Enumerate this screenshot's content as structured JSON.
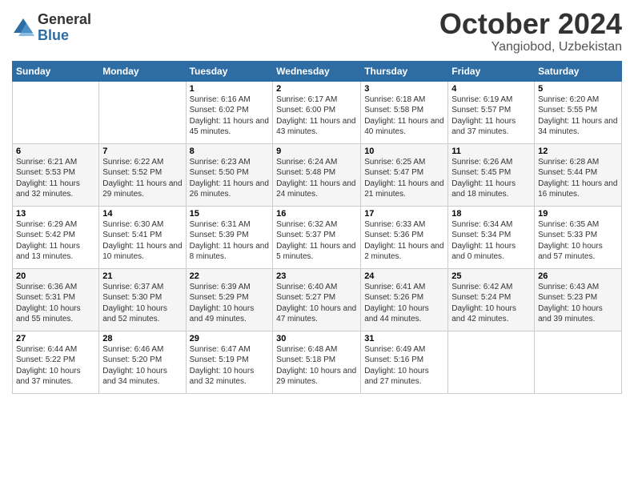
{
  "logo": {
    "general": "General",
    "blue": "Blue"
  },
  "title": "October 2024",
  "location": "Yangiobod, Uzbekistan",
  "days_of_week": [
    "Sunday",
    "Monday",
    "Tuesday",
    "Wednesday",
    "Thursday",
    "Friday",
    "Saturday"
  ],
  "weeks": [
    [
      {
        "num": "",
        "sunrise": "",
        "sunset": "",
        "daylight": ""
      },
      {
        "num": "",
        "sunrise": "",
        "sunset": "",
        "daylight": ""
      },
      {
        "num": "1",
        "sunrise": "Sunrise: 6:16 AM",
        "sunset": "Sunset: 6:02 PM",
        "daylight": "Daylight: 11 hours and 45 minutes."
      },
      {
        "num": "2",
        "sunrise": "Sunrise: 6:17 AM",
        "sunset": "Sunset: 6:00 PM",
        "daylight": "Daylight: 11 hours and 43 minutes."
      },
      {
        "num": "3",
        "sunrise": "Sunrise: 6:18 AM",
        "sunset": "Sunset: 5:58 PM",
        "daylight": "Daylight: 11 hours and 40 minutes."
      },
      {
        "num": "4",
        "sunrise": "Sunrise: 6:19 AM",
        "sunset": "Sunset: 5:57 PM",
        "daylight": "Daylight: 11 hours and 37 minutes."
      },
      {
        "num": "5",
        "sunrise": "Sunrise: 6:20 AM",
        "sunset": "Sunset: 5:55 PM",
        "daylight": "Daylight: 11 hours and 34 minutes."
      }
    ],
    [
      {
        "num": "6",
        "sunrise": "Sunrise: 6:21 AM",
        "sunset": "Sunset: 5:53 PM",
        "daylight": "Daylight: 11 hours and 32 minutes."
      },
      {
        "num": "7",
        "sunrise": "Sunrise: 6:22 AM",
        "sunset": "Sunset: 5:52 PM",
        "daylight": "Daylight: 11 hours and 29 minutes."
      },
      {
        "num": "8",
        "sunrise": "Sunrise: 6:23 AM",
        "sunset": "Sunset: 5:50 PM",
        "daylight": "Daylight: 11 hours and 26 minutes."
      },
      {
        "num": "9",
        "sunrise": "Sunrise: 6:24 AM",
        "sunset": "Sunset: 5:48 PM",
        "daylight": "Daylight: 11 hours and 24 minutes."
      },
      {
        "num": "10",
        "sunrise": "Sunrise: 6:25 AM",
        "sunset": "Sunset: 5:47 PM",
        "daylight": "Daylight: 11 hours and 21 minutes."
      },
      {
        "num": "11",
        "sunrise": "Sunrise: 6:26 AM",
        "sunset": "Sunset: 5:45 PM",
        "daylight": "Daylight: 11 hours and 18 minutes."
      },
      {
        "num": "12",
        "sunrise": "Sunrise: 6:28 AM",
        "sunset": "Sunset: 5:44 PM",
        "daylight": "Daylight: 11 hours and 16 minutes."
      }
    ],
    [
      {
        "num": "13",
        "sunrise": "Sunrise: 6:29 AM",
        "sunset": "Sunset: 5:42 PM",
        "daylight": "Daylight: 11 hours and 13 minutes."
      },
      {
        "num": "14",
        "sunrise": "Sunrise: 6:30 AM",
        "sunset": "Sunset: 5:41 PM",
        "daylight": "Daylight: 11 hours and 10 minutes."
      },
      {
        "num": "15",
        "sunrise": "Sunrise: 6:31 AM",
        "sunset": "Sunset: 5:39 PM",
        "daylight": "Daylight: 11 hours and 8 minutes."
      },
      {
        "num": "16",
        "sunrise": "Sunrise: 6:32 AM",
        "sunset": "Sunset: 5:37 PM",
        "daylight": "Daylight: 11 hours and 5 minutes."
      },
      {
        "num": "17",
        "sunrise": "Sunrise: 6:33 AM",
        "sunset": "Sunset: 5:36 PM",
        "daylight": "Daylight: 11 hours and 2 minutes."
      },
      {
        "num": "18",
        "sunrise": "Sunrise: 6:34 AM",
        "sunset": "Sunset: 5:34 PM",
        "daylight": "Daylight: 11 hours and 0 minutes."
      },
      {
        "num": "19",
        "sunrise": "Sunrise: 6:35 AM",
        "sunset": "Sunset: 5:33 PM",
        "daylight": "Daylight: 10 hours and 57 minutes."
      }
    ],
    [
      {
        "num": "20",
        "sunrise": "Sunrise: 6:36 AM",
        "sunset": "Sunset: 5:31 PM",
        "daylight": "Daylight: 10 hours and 55 minutes."
      },
      {
        "num": "21",
        "sunrise": "Sunrise: 6:37 AM",
        "sunset": "Sunset: 5:30 PM",
        "daylight": "Daylight: 10 hours and 52 minutes."
      },
      {
        "num": "22",
        "sunrise": "Sunrise: 6:39 AM",
        "sunset": "Sunset: 5:29 PM",
        "daylight": "Daylight: 10 hours and 49 minutes."
      },
      {
        "num": "23",
        "sunrise": "Sunrise: 6:40 AM",
        "sunset": "Sunset: 5:27 PM",
        "daylight": "Daylight: 10 hours and 47 minutes."
      },
      {
        "num": "24",
        "sunrise": "Sunrise: 6:41 AM",
        "sunset": "Sunset: 5:26 PM",
        "daylight": "Daylight: 10 hours and 44 minutes."
      },
      {
        "num": "25",
        "sunrise": "Sunrise: 6:42 AM",
        "sunset": "Sunset: 5:24 PM",
        "daylight": "Daylight: 10 hours and 42 minutes."
      },
      {
        "num": "26",
        "sunrise": "Sunrise: 6:43 AM",
        "sunset": "Sunset: 5:23 PM",
        "daylight": "Daylight: 10 hours and 39 minutes."
      }
    ],
    [
      {
        "num": "27",
        "sunrise": "Sunrise: 6:44 AM",
        "sunset": "Sunset: 5:22 PM",
        "daylight": "Daylight: 10 hours and 37 minutes."
      },
      {
        "num": "28",
        "sunrise": "Sunrise: 6:46 AM",
        "sunset": "Sunset: 5:20 PM",
        "daylight": "Daylight: 10 hours and 34 minutes."
      },
      {
        "num": "29",
        "sunrise": "Sunrise: 6:47 AM",
        "sunset": "Sunset: 5:19 PM",
        "daylight": "Daylight: 10 hours and 32 minutes."
      },
      {
        "num": "30",
        "sunrise": "Sunrise: 6:48 AM",
        "sunset": "Sunset: 5:18 PM",
        "daylight": "Daylight: 10 hours and 29 minutes."
      },
      {
        "num": "31",
        "sunrise": "Sunrise: 6:49 AM",
        "sunset": "Sunset: 5:16 PM",
        "daylight": "Daylight: 10 hours and 27 minutes."
      },
      {
        "num": "",
        "sunrise": "",
        "sunset": "",
        "daylight": ""
      },
      {
        "num": "",
        "sunrise": "",
        "sunset": "",
        "daylight": ""
      }
    ]
  ]
}
